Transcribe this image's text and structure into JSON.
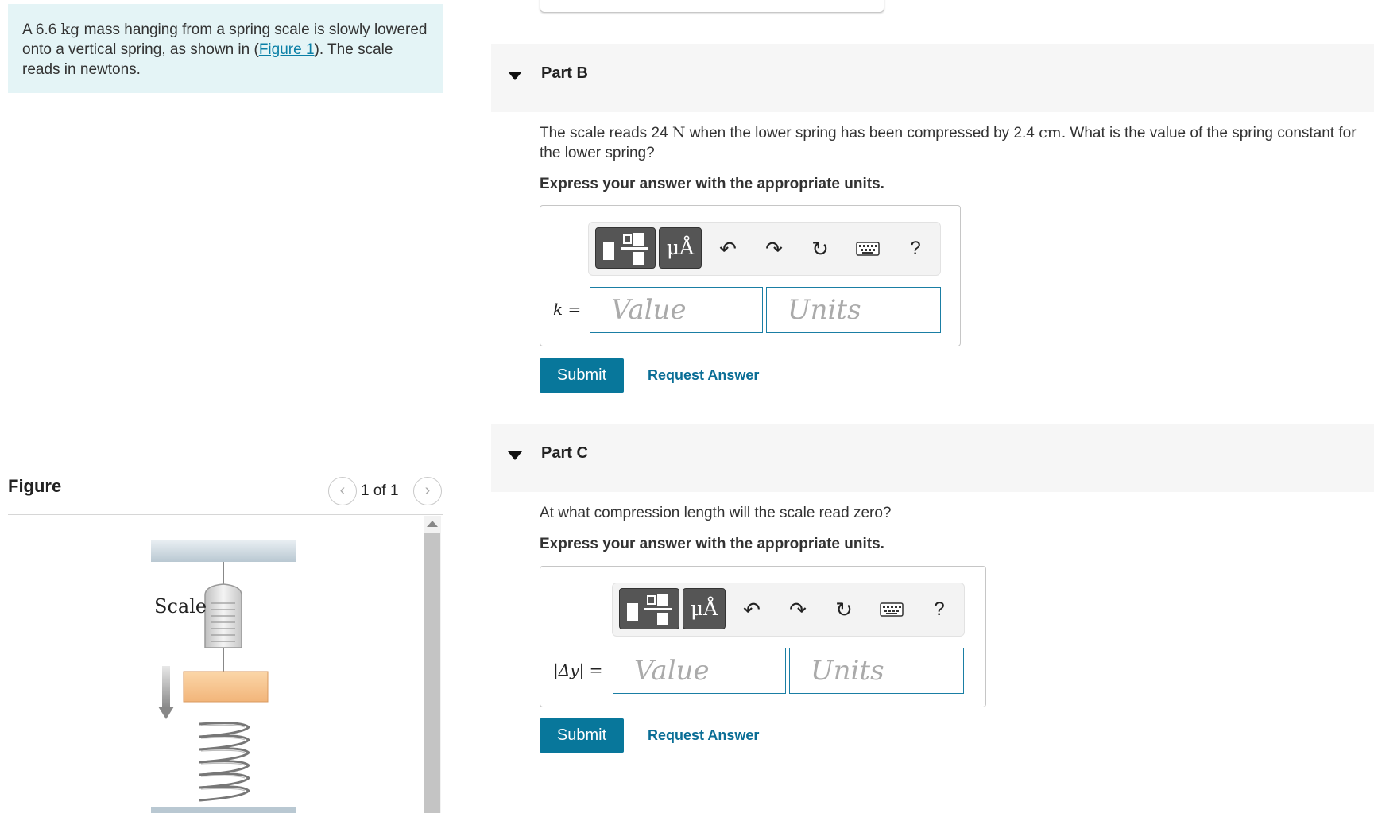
{
  "problem": {
    "text_pre": "A 6.6 ",
    "mass_unit": "kg",
    "text_mid": " mass hanging from a spring scale is slowly lowered onto a vertical spring, as shown in (",
    "figure_link": "Figure 1",
    "text_post": "). The scale reads in newtons."
  },
  "figure": {
    "title": "Figure",
    "pager": "1 of 1",
    "prev_icon": "chevron-left-icon",
    "next_icon": "chevron-right-icon",
    "scale_label": "Scale"
  },
  "part_b": {
    "title": "Part B",
    "q_pre": "The scale reads 24 ",
    "q_unit_n": "N",
    "q_mid": " when the lower spring has been compressed by 2.4 ",
    "q_unit_cm": "cm",
    "q_post": ". What is the value of the spring constant for the lower spring?",
    "instruction": "Express your answer with the appropriate units.",
    "variable": "k =",
    "value_placeholder": "Value",
    "units_placeholder": "Units",
    "submit": "Submit",
    "request": "Request Answer"
  },
  "part_c": {
    "title": "Part C",
    "question": "At what compression length will the scale read zero?",
    "instruction": "Express your answer with the appropriate units.",
    "variable": "|Δy| =",
    "value_placeholder": "Value",
    "units_placeholder": "Units",
    "submit": "Submit",
    "request": "Request Answer"
  },
  "toolbar": {
    "units_tool": "μÅ",
    "help": "?",
    "icons": [
      "templates-icon",
      "units-icon",
      "undo-icon",
      "redo-icon",
      "reset-icon",
      "keyboard-icon",
      "help-icon"
    ]
  },
  "colors": {
    "accent": "#08779b",
    "prompt_bg": "#e4f4f6",
    "input_border": "#1a7ea4"
  }
}
